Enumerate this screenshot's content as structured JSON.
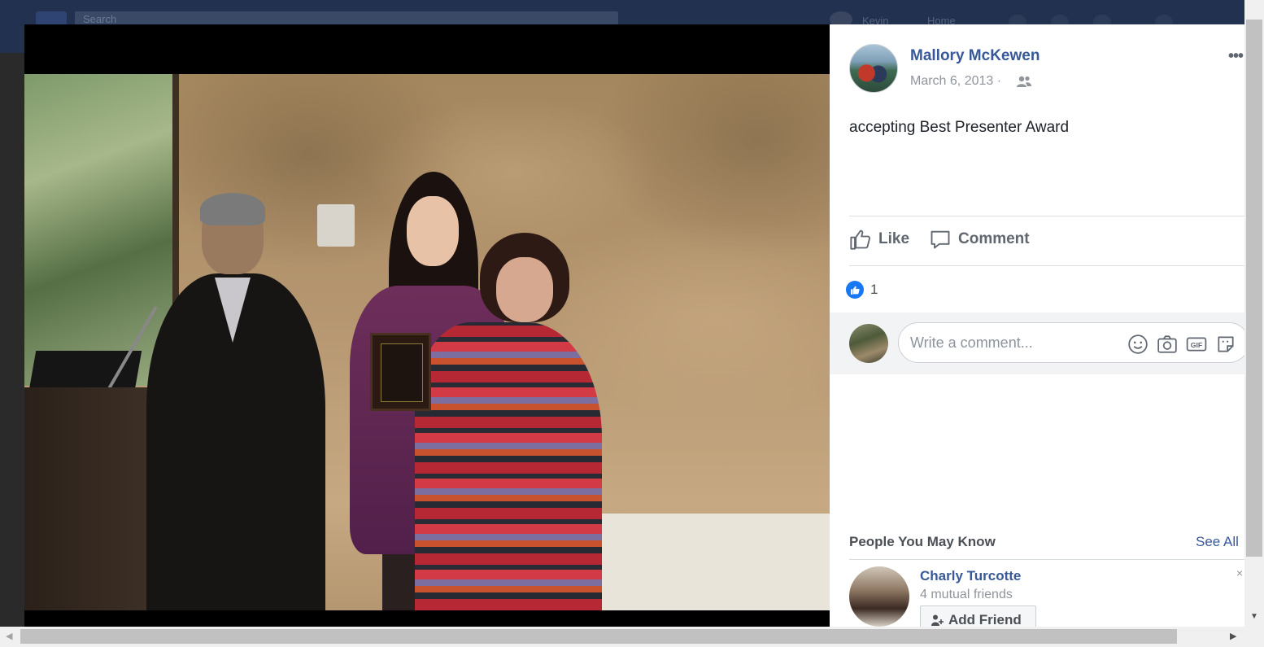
{
  "background": {
    "search_placeholder": "Search",
    "profile_name": "Kevin",
    "home_label": "Home"
  },
  "post": {
    "author": "Mallory McKewen",
    "date": "March 6, 2013 ·",
    "audience_icon": "friends-icon",
    "more_label": "•••",
    "caption": "accepting Best Presenter Award",
    "like_label": "Like",
    "comment_label": "Comment",
    "reactions_count": "1",
    "comment_placeholder": "Write a comment..."
  },
  "pymk": {
    "title": "People You May Know",
    "see_all": "See All",
    "person": {
      "name": "Charly Turcotte",
      "mutual": "4 mutual friends",
      "add_label": "Add Friend",
      "close_label": "×"
    }
  },
  "colors": {
    "link_blue": "#385898",
    "like_blue": "#1877f2",
    "muted": "#90949c"
  }
}
